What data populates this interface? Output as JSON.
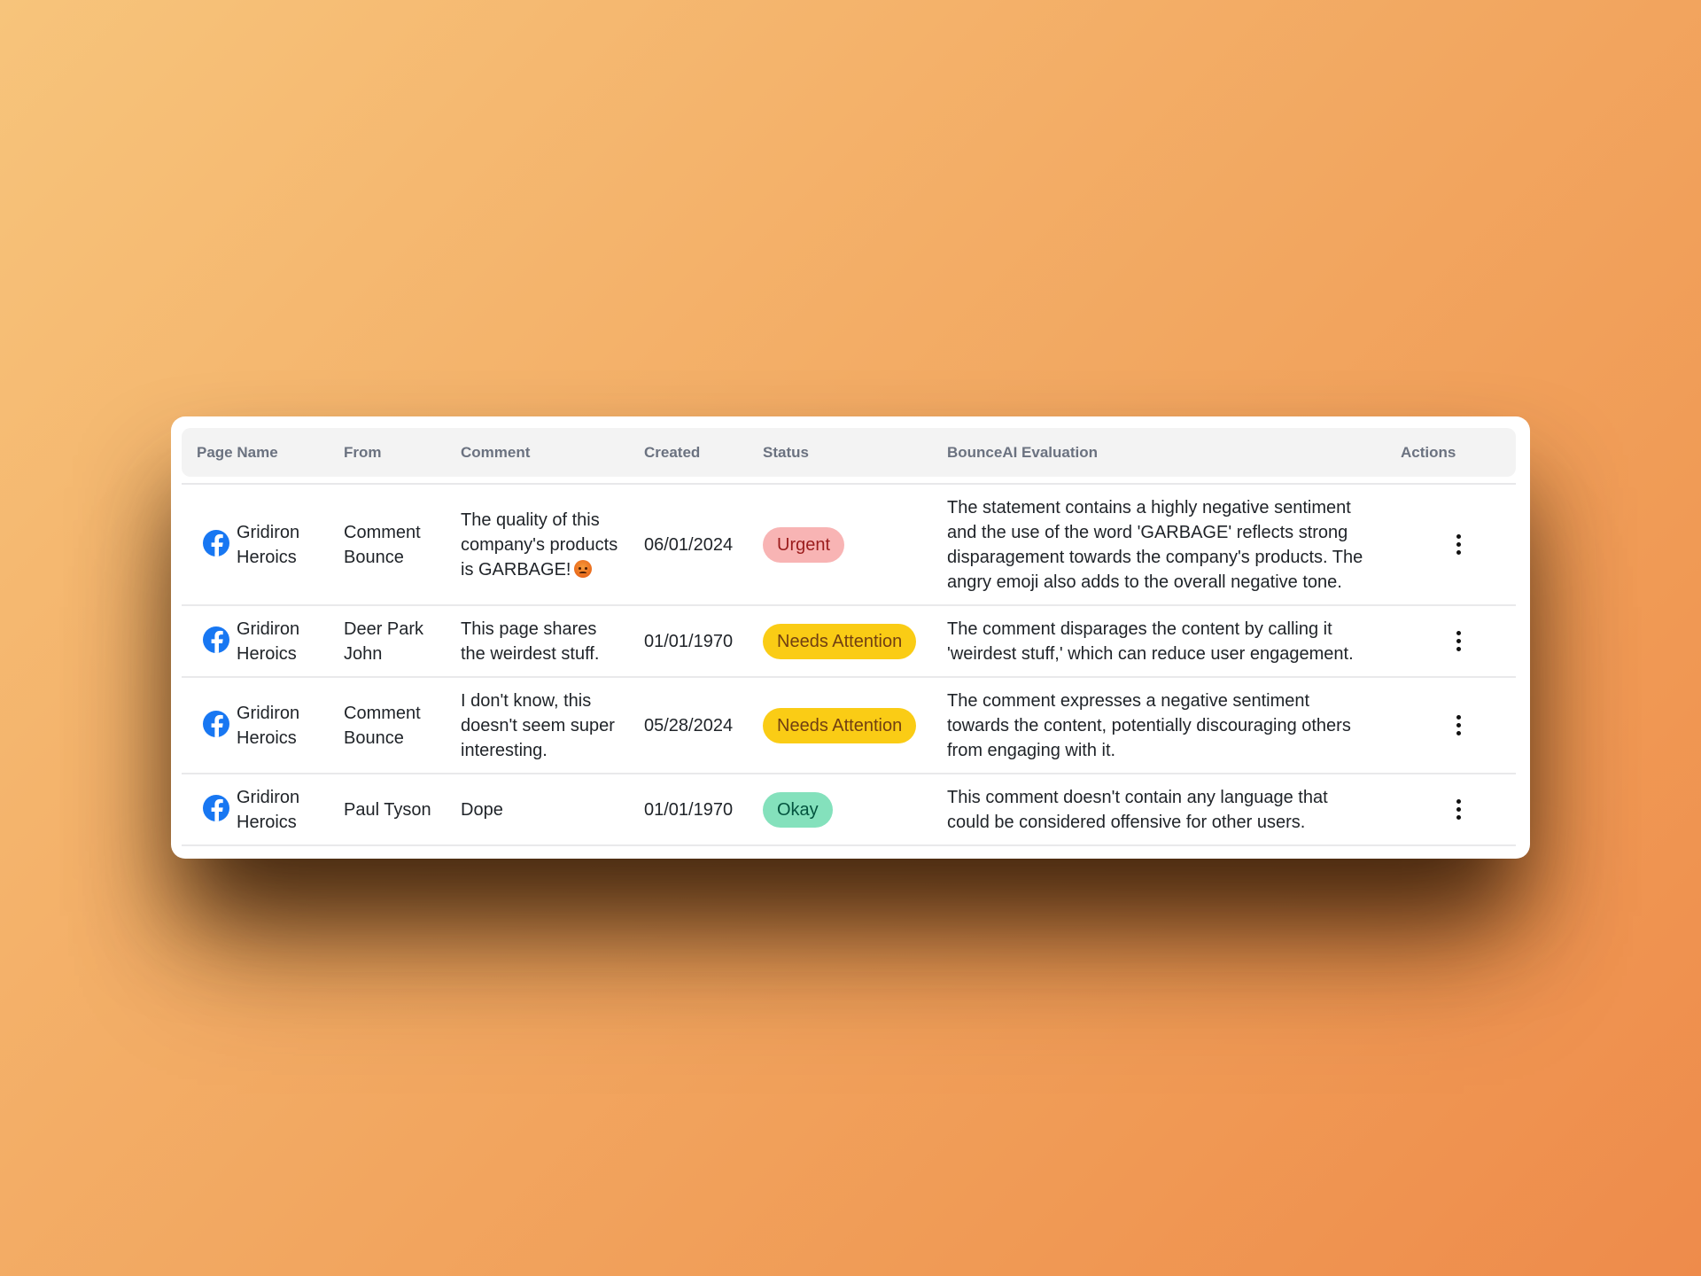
{
  "colors": {
    "urgent_bg": "#f8b4b4",
    "urgent_text": "#9b1c1c",
    "attention_bg": "#facc15",
    "attention_text": "#713f12",
    "okay_bg": "#84e1bc",
    "okay_text": "#03543f",
    "facebook_blue": "#1877f2"
  },
  "table": {
    "columns": [
      "Page Name",
      "From",
      "Comment",
      "Created",
      "Status",
      "BounceAI Evaluation",
      "Actions"
    ],
    "rows": [
      {
        "page_icon": "facebook-icon",
        "page_name": "Gridiron Heroics",
        "from": "Comment Bounce",
        "comment": "The quality of this company's products is GARBAGE!",
        "comment_emoji": "😡",
        "created": "06/01/2024",
        "status": "Urgent",
        "evaluation": "The statement contains a highly negative sentiment and the use of the word 'GARBAGE' reflects strong disparagement towards the company's products. The angry emoji also adds to the overall negative tone.",
        "action_icon": "more-vertical-icon"
      },
      {
        "page_icon": "facebook-icon",
        "page_name": "Gridiron Heroics",
        "from": "Deer Park John",
        "comment": "This page shares the weirdest stuff.",
        "created": "01/01/1970",
        "status": "Needs Attention",
        "evaluation": "The comment disparages the content by calling it 'weirdest stuff,' which can reduce user engagement.",
        "action_icon": "more-vertical-icon"
      },
      {
        "page_icon": "facebook-icon",
        "page_name": "Gridiron Heroics",
        "from": "Comment Bounce",
        "comment": "I don't know, this doesn't seem super interesting.",
        "created": "05/28/2024",
        "status": "Needs Attention",
        "evaluation": "The comment expresses a negative sentiment towards the content, potentially discouraging others from engaging with it.",
        "action_icon": "more-vertical-icon"
      },
      {
        "page_icon": "facebook-icon",
        "page_name": "Gridiron Heroics",
        "from": "Paul Tyson",
        "comment": "Dope",
        "created": "01/01/1970",
        "status": "Okay",
        "evaluation": "This comment doesn't contain any language that could be considered offensive for other users.",
        "action_icon": "more-vertical-icon"
      }
    ]
  }
}
